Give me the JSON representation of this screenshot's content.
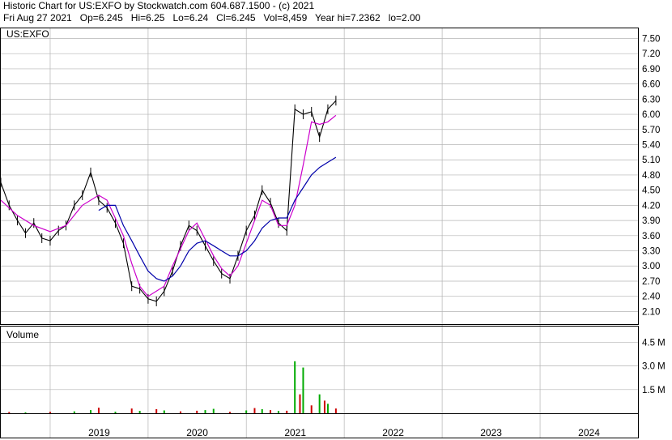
{
  "header": {
    "line1": "Historic Chart for US:EXFO by Stockwatch.com 604.687.1500 - (c) 2021",
    "line2": "Fri Aug 27 2021   Op=6.245   Hi=6.25   Lo=6.24   Cl=6.245   Vol=8,459   Year hi=7.2362   lo=2.00"
  },
  "colors": {
    "price": "#000000",
    "ma_short": "#cc00cc",
    "ma_long": "#0000aa",
    "vol_up": "#00aa00",
    "vol_down": "#cc0000",
    "grid": "#b4b4b4"
  },
  "chart_data": [
    {
      "type": "line",
      "title": "US:EXFO",
      "x_range": [
        "2018-07-01",
        "2024-12-31"
      ],
      "x_tick_labels": [
        "2019",
        "2020",
        "2021",
        "2022",
        "2023",
        "2024"
      ],
      "ylim": [
        1.85,
        7.7
      ],
      "y_ticks": [
        "7.50",
        "7.20",
        "6.90",
        "6.60",
        "6.30",
        "6.00",
        "5.70",
        "5.40",
        "5.10",
        "4.80",
        "4.50",
        "4.20",
        "3.90",
        "3.60",
        "3.30",
        "3.00",
        "2.70",
        "2.40",
        "2.10"
      ],
      "grid": true,
      "series": [
        {
          "style": "price-bars",
          "points": [
            [
              "2018-07-01",
              4.65
            ],
            [
              "2018-08-01",
              4.2
            ],
            [
              "2018-09-01",
              3.9
            ],
            [
              "2018-10-01",
              3.65
            ],
            [
              "2018-11-01",
              3.85
            ],
            [
              "2018-12-01",
              3.55
            ],
            [
              "2019-01-01",
              3.5
            ],
            [
              "2019-02-01",
              3.7
            ],
            [
              "2019-03-01",
              3.8
            ],
            [
              "2019-04-01",
              4.2
            ],
            [
              "2019-05-01",
              4.4
            ],
            [
              "2019-06-01",
              4.85
            ],
            [
              "2019-07-01",
              4.3
            ],
            [
              "2019-08-01",
              4.15
            ],
            [
              "2019-09-01",
              3.85
            ],
            [
              "2019-10-01",
              3.45
            ],
            [
              "2019-11-01",
              2.6
            ],
            [
              "2019-12-01",
              2.55
            ],
            [
              "2020-01-01",
              2.35
            ],
            [
              "2020-02-01",
              2.3
            ],
            [
              "2020-03-01",
              2.5
            ],
            [
              "2020-04-01",
              2.9
            ],
            [
              "2020-05-01",
              3.4
            ],
            [
              "2020-06-01",
              3.8
            ],
            [
              "2020-07-01",
              3.7
            ],
            [
              "2020-08-01",
              3.4
            ],
            [
              "2020-09-01",
              3.1
            ],
            [
              "2020-10-01",
              2.85
            ],
            [
              "2020-11-01",
              2.75
            ],
            [
              "2020-12-01",
              3.2
            ],
            [
              "2021-01-01",
              3.7
            ],
            [
              "2021-02-01",
              4.0
            ],
            [
              "2021-03-01",
              4.5
            ],
            [
              "2021-04-01",
              4.25
            ],
            [
              "2021-05-01",
              3.85
            ],
            [
              "2021-06-01",
              3.7
            ],
            [
              "2021-07-01",
              6.1
            ],
            [
              "2021-08-01",
              6.0
            ],
            [
              "2021-09-01",
              6.05
            ],
            [
              "2021-10-01",
              5.55
            ],
            [
              "2021-11-01",
              6.1
            ],
            [
              "2021-12-01",
              6.27
            ]
          ]
        },
        {
          "style": "moving-average-short",
          "points": [
            [
              "2018-07-01",
              4.3
            ],
            [
              "2018-09-01",
              4.0
            ],
            [
              "2018-11-01",
              3.8
            ],
            [
              "2019-01-01",
              3.68
            ],
            [
              "2019-03-01",
              3.8
            ],
            [
              "2019-05-01",
              4.2
            ],
            [
              "2019-07-01",
              4.4
            ],
            [
              "2019-08-01",
              4.3
            ],
            [
              "2019-10-01",
              3.6
            ],
            [
              "2019-11-01",
              3.05
            ],
            [
              "2019-12-01",
              2.6
            ],
            [
              "2020-01-01",
              2.4
            ],
            [
              "2020-03-01",
              2.6
            ],
            [
              "2020-04-01",
              3.0
            ],
            [
              "2020-06-01",
              3.7
            ],
            [
              "2020-07-01",
              3.85
            ],
            [
              "2020-09-01",
              3.2
            ],
            [
              "2020-10-01",
              2.95
            ],
            [
              "2020-11-01",
              2.8
            ],
            [
              "2020-12-01",
              3.0
            ],
            [
              "2021-01-01",
              3.45
            ],
            [
              "2021-02-01",
              3.9
            ],
            [
              "2021-03-01",
              4.3
            ],
            [
              "2021-04-01",
              4.2
            ],
            [
              "2021-05-01",
              3.8
            ],
            [
              "2021-06-01",
              3.8
            ],
            [
              "2021-07-01",
              4.2
            ],
            [
              "2021-08-01",
              5.0
            ],
            [
              "2021-09-01",
              5.85
            ],
            [
              "2021-10-01",
              5.8
            ],
            [
              "2021-11-01",
              5.85
            ],
            [
              "2021-12-01",
              5.98
            ]
          ]
        },
        {
          "style": "moving-average-long",
          "points": [
            [
              "2019-07-01",
              4.1
            ],
            [
              "2019-08-01",
              4.2
            ],
            [
              "2019-09-01",
              4.2
            ],
            [
              "2019-10-01",
              3.8
            ],
            [
              "2019-11-01",
              3.5
            ],
            [
              "2019-12-01",
              3.2
            ],
            [
              "2020-01-01",
              2.9
            ],
            [
              "2020-02-01",
              2.75
            ],
            [
              "2020-03-01",
              2.7
            ],
            [
              "2020-04-01",
              2.8
            ],
            [
              "2020-05-01",
              3.0
            ],
            [
              "2020-06-01",
              3.3
            ],
            [
              "2020-07-01",
              3.45
            ],
            [
              "2020-08-01",
              3.5
            ],
            [
              "2020-09-01",
              3.4
            ],
            [
              "2020-10-01",
              3.3
            ],
            [
              "2020-11-01",
              3.2
            ],
            [
              "2020-12-01",
              3.2
            ],
            [
              "2021-01-01",
              3.3
            ],
            [
              "2021-02-01",
              3.5
            ],
            [
              "2021-03-01",
              3.75
            ],
            [
              "2021-04-01",
              3.9
            ],
            [
              "2021-05-01",
              3.95
            ],
            [
              "2021-06-01",
              3.95
            ],
            [
              "2021-07-01",
              4.3
            ],
            [
              "2021-08-01",
              4.55
            ],
            [
              "2021-09-01",
              4.8
            ],
            [
              "2021-10-01",
              4.95
            ],
            [
              "2021-11-01",
              5.05
            ],
            [
              "2021-12-01",
              5.15
            ]
          ]
        }
      ]
    },
    {
      "type": "bar",
      "title": "Volume",
      "x_range": [
        "2018-07-01",
        "2024-12-31"
      ],
      "ylim": [
        0,
        5500000
      ],
      "y_ticks": [
        "4.5 M",
        "3.0 M",
        "1.5 M"
      ],
      "grid": true,
      "series": [
        {
          "points": [
            [
              "2018-08-01",
              80000,
              "down"
            ],
            [
              "2018-10-01",
              60000,
              "up"
            ],
            [
              "2019-01-01",
              90000,
              "down"
            ],
            [
              "2019-04-01",
              120000,
              "up"
            ],
            [
              "2019-06-01",
              200000,
              "up"
            ],
            [
              "2019-07-01",
              350000,
              "down"
            ],
            [
              "2019-09-01",
              100000,
              "up"
            ],
            [
              "2019-11-01",
              300000,
              "down"
            ],
            [
              "2019-12-01",
              150000,
              "up"
            ],
            [
              "2020-02-01",
              260000,
              "down"
            ],
            [
              "2020-03-01",
              180000,
              "up"
            ],
            [
              "2020-05-01",
              120000,
              "down"
            ],
            [
              "2020-07-01",
              160000,
              "down"
            ],
            [
              "2020-08-01",
              200000,
              "up"
            ],
            [
              "2020-09-01",
              280000,
              "up"
            ],
            [
              "2020-11-01",
              90000,
              "down"
            ],
            [
              "2021-01-01",
              180000,
              "up"
            ],
            [
              "2021-02-01",
              330000,
              "down"
            ],
            [
              "2021-03-01",
              260000,
              "up"
            ],
            [
              "2021-04-01",
              200000,
              "down"
            ],
            [
              "2021-05-01",
              150000,
              "up"
            ],
            [
              "2021-06-01",
              160000,
              "down"
            ],
            [
              "2021-07-01",
              3300000,
              "up"
            ],
            [
              "2021-07-20",
              1200000,
              "down"
            ],
            [
              "2021-08-01",
              2900000,
              "up"
            ],
            [
              "2021-09-01",
              500000,
              "down"
            ],
            [
              "2021-10-01",
              1200000,
              "up"
            ],
            [
              "2021-10-20",
              800000,
              "down"
            ],
            [
              "2021-11-01",
              600000,
              "up"
            ],
            [
              "2021-12-01",
              300000,
              "down"
            ]
          ]
        }
      ]
    }
  ]
}
